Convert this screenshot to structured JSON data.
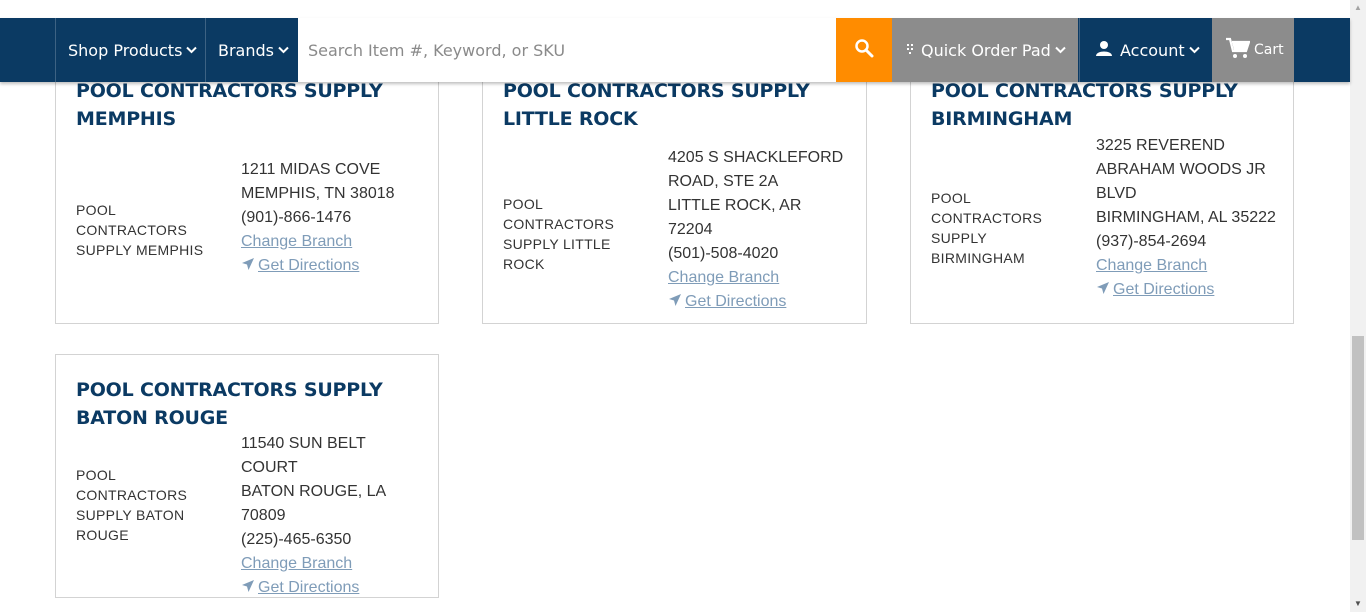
{
  "nav": {
    "shop_products": "Shop Products",
    "brands": "Brands",
    "search_placeholder": "Search Item #, Keyword, or SKU",
    "quick_order_pad": "Quick Order Pad",
    "account": "Account",
    "cart": "Cart"
  },
  "colors": {
    "nav_bg": "#0b3a63",
    "search_button": "#ff8c00",
    "title": "#0b3a63",
    "link": "#7f9cb8"
  },
  "branches": [
    {
      "title_line1": "POOL CONTRACTORS SUPPLY",
      "title_line2": "MEMPHIS",
      "image_alt": "POOL CONTRACTORS SUPPLY MEMPHIS",
      "address_lines": [
        "1211 MIDAS COVE",
        "MEMPHIS, TN 38018"
      ],
      "phone": "(901)-866-1476",
      "change_branch": "Change Branch",
      "get_directions": "Get Directions"
    },
    {
      "title_line1": "POOL CONTRACTORS SUPPLY",
      "title_line2": "LITTLE ROCK",
      "image_alt": "POOL CONTRACTORS SUPPLY LITTLE ROCK",
      "address_lines": [
        "4205 S SHACKLEFORD",
        "ROAD, STE 2A",
        "LITTLE ROCK, AR 72204"
      ],
      "phone": "(501)-508-4020",
      "change_branch": "Change Branch",
      "get_directions": "Get Directions"
    },
    {
      "title_line1": "POOL CONTRACTORS SUPPLY",
      "title_line2": "BIRMINGHAM",
      "image_alt": "POOL CONTRACTORS SUPPLY BIRMINGHAM",
      "address_lines": [
        "3225 REVEREND",
        "ABRAHAM WOODS JR",
        "BLVD",
        "BIRMINGHAM, AL 35222"
      ],
      "phone": "(937)-854-2694",
      "change_branch": "Change Branch",
      "get_directions": "Get Directions"
    },
    {
      "title_line1": "POOL CONTRACTORS SUPPLY",
      "title_line2": "BATON ROUGE",
      "image_alt": "POOL CONTRACTORS SUPPLY BATON ROUGE",
      "address_lines": [
        "11540 SUN BELT COURT",
        "BATON ROUGE, LA",
        "70809"
      ],
      "phone": "(225)-465-6350",
      "change_branch": "Change Branch",
      "get_directions": "Get Directions"
    }
  ]
}
